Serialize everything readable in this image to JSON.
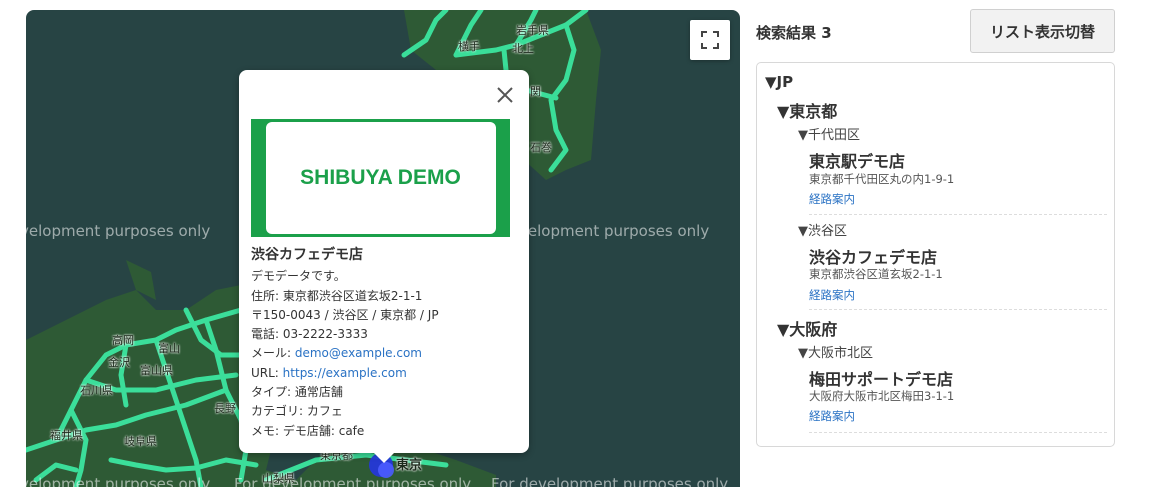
{
  "map": {
    "dev_watermark": "For development purposes only",
    "dev_watermark_fragment": "velopment purposes only",
    "fullscreen_icon": "fullscreen-icon",
    "place_labels": {
      "iwate": "岩手県",
      "yokote": "横手",
      "kitakami": "北上",
      "ishinomaki": "石巻",
      "sekine": "関",
      "takaoka": "高岡",
      "toyama": "富山",
      "kanazawa": "金沢",
      "toyama_pref": "富山県",
      "ishikawa": "石川県",
      "nagano": "長野",
      "fukui": "福井県",
      "gifu": "岐阜県",
      "tokyo": "東京",
      "yamanashi": "山梨県",
      "toukyoutou": "東京都"
    }
  },
  "popup": {
    "close_icon": "close-icon",
    "logo_text": "SHIBUYA DEMO",
    "title": "渋谷カフェデモ店",
    "description": "デモデータです。",
    "address": "住所: 東京都渋谷区道玄坂2-1-1",
    "postal": "〒150-0043 / 渋谷区 / 東京都 / JP",
    "phone": "電話: 03-2222-3333",
    "email_label": "メール: ",
    "email": "demo@example.com",
    "url_label": "URL: ",
    "url": "https://example.com",
    "type": "タイプ: 通常店舗",
    "category": "カテゴリ: カフェ",
    "memo": "メモ: デモ店舗: cafe"
  },
  "results": {
    "count_label": "検索結果 3",
    "toggle_button": "リスト表示切替",
    "country": "▼JP",
    "prefectures": [
      {
        "label": "▼東京都",
        "cities": [
          {
            "label": "▼千代田区",
            "stores": [
              {
                "name": "東京駅デモ店",
                "address": "東京都千代田区丸の内1-9-1",
                "link": "経路案内"
              }
            ]
          },
          {
            "label": "▼渋谷区",
            "stores": [
              {
                "name": "渋谷カフェデモ店",
                "address": "東京都渋谷区道玄坂2-1-1",
                "link": "経路案内"
              }
            ]
          }
        ]
      },
      {
        "label": "▼大阪府",
        "cities": [
          {
            "label": "▼大阪市北区",
            "stores": [
              {
                "name": "梅田サポートデモ店",
                "address": "大阪府大阪市北区梅田3-1-1",
                "link": "経路案内"
              }
            ]
          }
        ]
      }
    ]
  },
  "colors": {
    "map_water": "#274444",
    "map_land": "#2e5a35",
    "road": "#3ce6a0",
    "brand_green": "#1ba04a",
    "link_blue": "#2a72c4"
  }
}
